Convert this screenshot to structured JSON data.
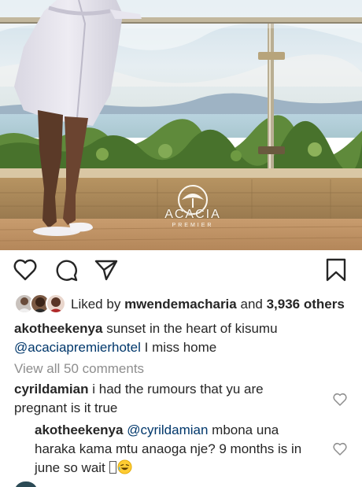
{
  "photo": {
    "brand_name": "ACACIA",
    "brand_sub": "PREMIER"
  },
  "actions": {
    "like_icon": "heart-outline-icon",
    "comment_icon": "comment-bubble-icon",
    "share_icon": "paper-plane-icon",
    "save_icon": "bookmark-icon"
  },
  "likes": {
    "prefix": "Liked by",
    "user": "mwendemacharia",
    "and": "and",
    "others": "3,936 others"
  },
  "caption": {
    "user": "akotheekenya",
    "text": "sunset in the heart of kisumu",
    "mention": "@acaciapremierhotel",
    "text2": "I miss home"
  },
  "view_all": "View all 50 comments",
  "comments": [
    {
      "user": "cyrildamian",
      "text": "i had the rumours that yu are pregnant is it true"
    },
    {
      "user": "akotheekenya",
      "mention": "@cyrildamian",
      "text": "mbona una haraka kama mtu anaoga nje? 9 months is in june so wait"
    }
  ]
}
